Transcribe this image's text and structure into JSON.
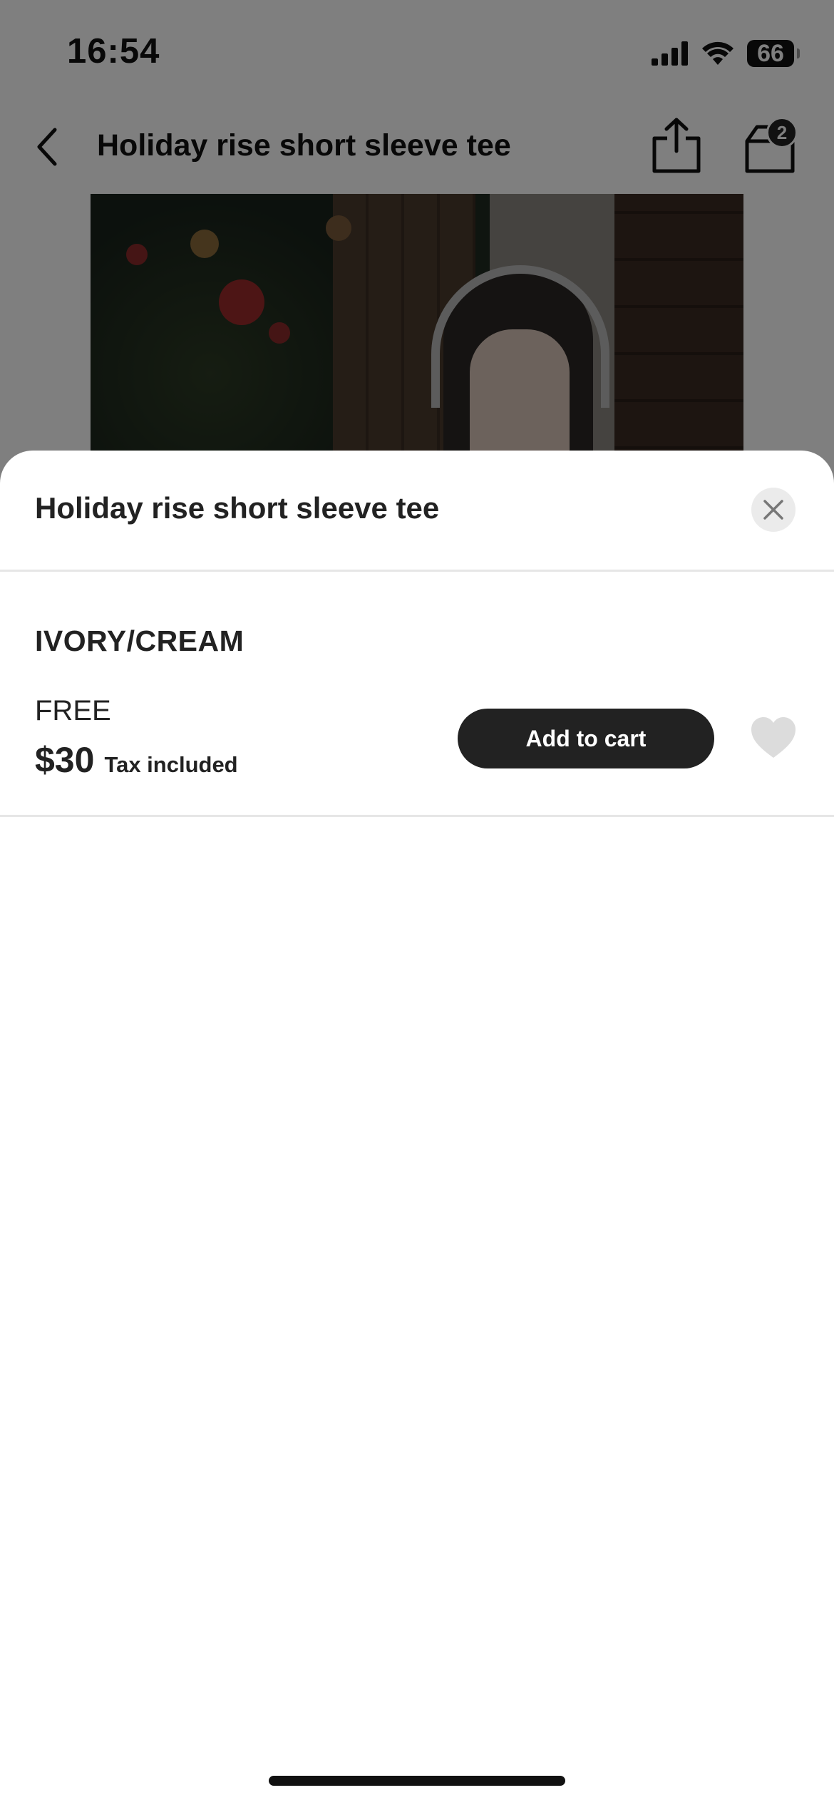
{
  "status_bar": {
    "time": "16:54",
    "battery": "66",
    "icons": [
      "cellular-signal-icon",
      "wifi-icon",
      "battery-icon"
    ]
  },
  "nav": {
    "title": "Holiday rise short sleeve tee",
    "cart_count": "2",
    "icons": [
      "chevron-left-icon",
      "share-icon",
      "shopping-bag-icon"
    ]
  },
  "sheet": {
    "title": "Holiday rise short sleeve tee",
    "color": "IVORY/CREAM",
    "size": "FREE",
    "price": "$30",
    "tax_note": "Tax included",
    "add_to_cart_label": "Add to cart",
    "icons": [
      "close-icon",
      "heart-icon"
    ]
  },
  "colors": {
    "button_bg": "#222222",
    "wishlist_heart": "#dcdcdc",
    "overlay": "rgba(0,0,0,0.5)"
  }
}
